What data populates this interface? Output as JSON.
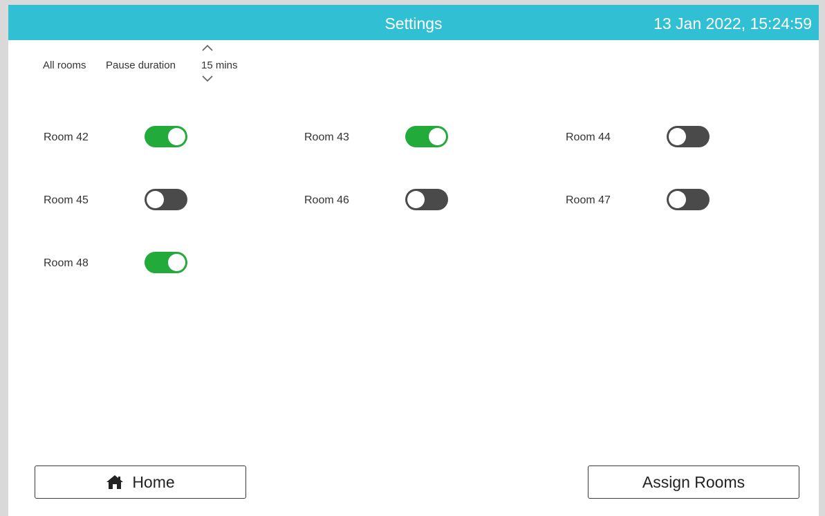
{
  "header": {
    "title": "Settings",
    "datetime": "13 Jan 2022, 15:24:59",
    "color": "#31c0d3"
  },
  "controls": {
    "all_rooms_label": "All rooms",
    "pause_label": "Pause duration",
    "pause_value": "15 mins",
    "up_icon": "chevron-up-icon",
    "down_icon": "chevron-down-icon"
  },
  "rooms": [
    {
      "label": "Room 42",
      "enabled": true
    },
    {
      "label": "Room 43",
      "enabled": true
    },
    {
      "label": "Room 44",
      "enabled": false
    },
    {
      "label": "Room 45",
      "enabled": false
    },
    {
      "label": "Room 46",
      "enabled": false
    },
    {
      "label": "Room 47",
      "enabled": false
    },
    {
      "label": "Room 48",
      "enabled": true
    }
  ],
  "colors": {
    "toggle_on": "#22aa3a",
    "toggle_off": "#4a4a4a"
  },
  "footer": {
    "home_label": "Home",
    "home_icon": "home-icon",
    "assign_label": "Assign Rooms"
  }
}
